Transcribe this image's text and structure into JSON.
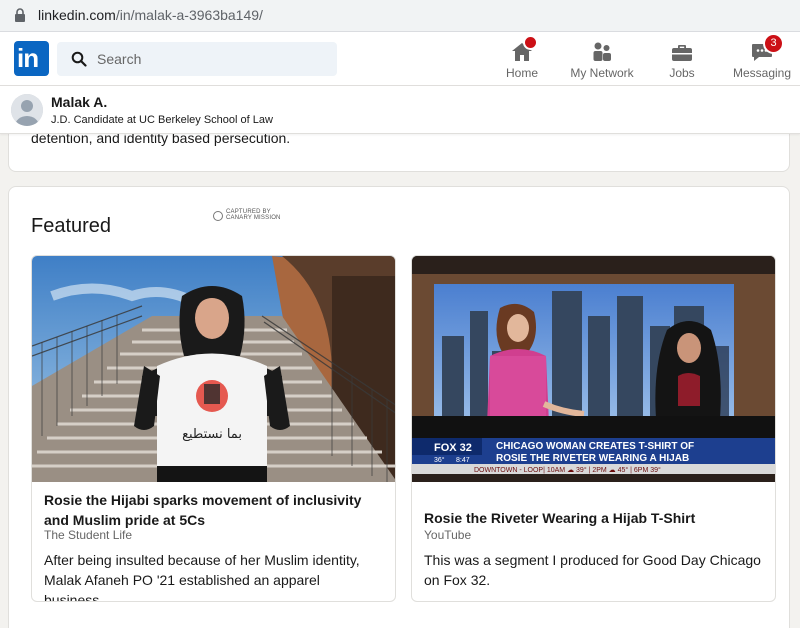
{
  "browser": {
    "url_host": "linkedin.com",
    "url_path": "/in/malak-a-3963ba149/"
  },
  "nav": {
    "logo_text": "in",
    "search_placeholder": "Search",
    "items": [
      {
        "label": "Home",
        "icon": "home-icon",
        "badge": ""
      },
      {
        "label": "My Network",
        "icon": "network-icon",
        "badge": ""
      },
      {
        "label": "Jobs",
        "icon": "briefcase-icon",
        "badge": ""
      },
      {
        "label": "Messaging",
        "icon": "messaging-icon",
        "badge": "3"
      }
    ]
  },
  "profile": {
    "name": "Malak A.",
    "headline": "J.D. Candidate at UC Berkeley School of Law"
  },
  "about": {
    "text_tail": "detention, and identity based persecution."
  },
  "watermark": {
    "line1": "CAPTURED BY",
    "line2": "CANARY MISSION"
  },
  "featured": {
    "title": "Featured",
    "items": [
      {
        "title": "Rosie the Hijabi sparks movement of inclusivity and Muslim pride at 5Cs",
        "source": "The Student Life",
        "description": "After being insulted because of her Muslim identity, Malak Afaneh PO '21 established an apparel business...",
        "shirt_text": "بما نستطيع"
      },
      {
        "title": "Rosie the Riveter Wearing a Hijab T-Shirt",
        "source": "YouTube",
        "description": "This was a segment I produced for Good Day Chicago on Fox 32.",
        "tv": {
          "channel": "FOX 32",
          "headline_1": "CHICAGO WOMAN CREATES T-SHIRT OF",
          "headline_2": "ROSIE THE RIVETER WEARING A HIJAB",
          "temp": "36°",
          "time": "8:47",
          "ticker": "DOWNTOWN - LOOP| 10AM ☁ 39° | 2PM ☁ 45° | 6PM 39°"
        }
      }
    ]
  },
  "colors": {
    "brand": "#0a66c2",
    "badge": "#cc1016",
    "page_bg": "#f3f2ef"
  }
}
